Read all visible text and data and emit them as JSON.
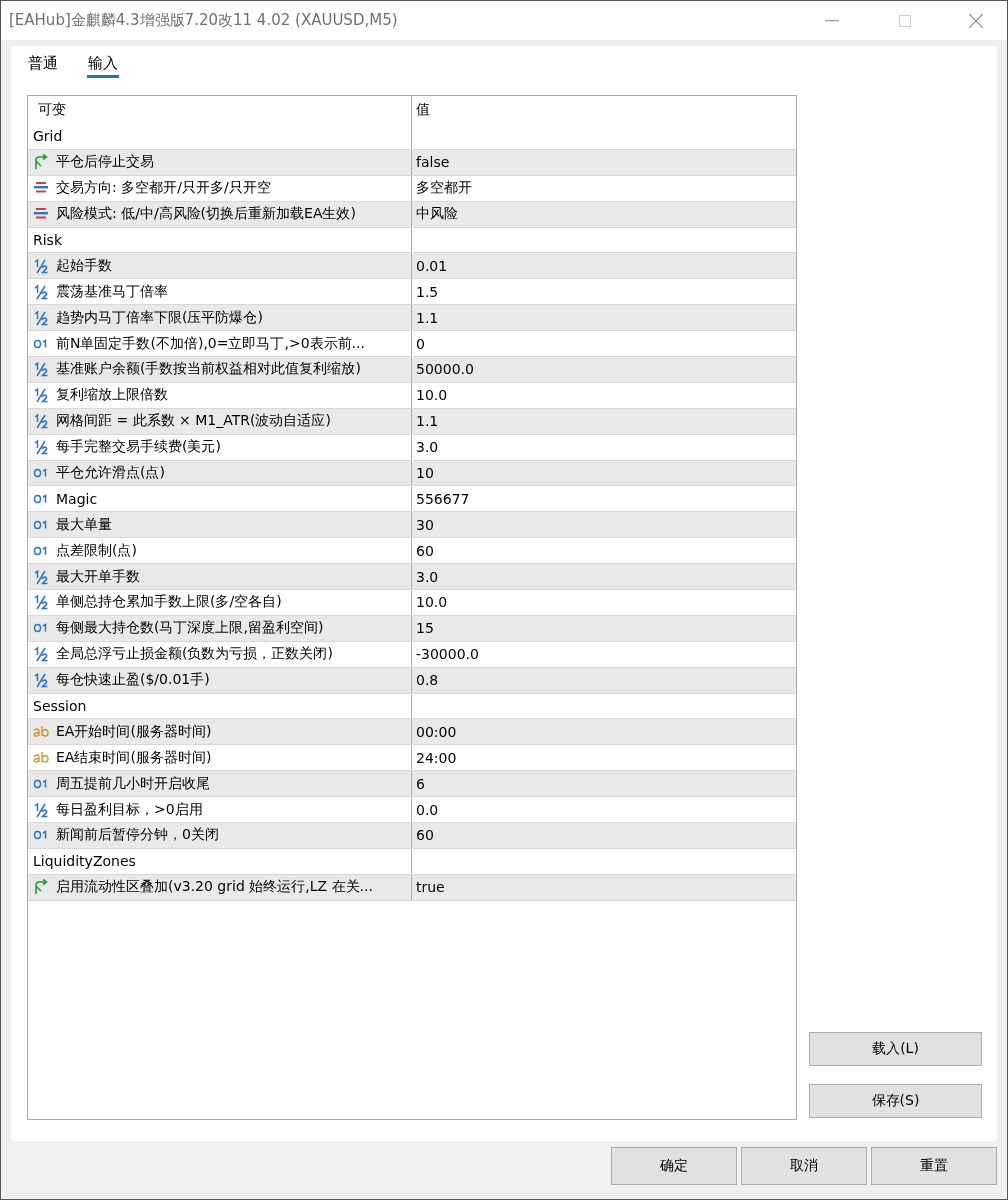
{
  "window": {
    "title": "[EAHub]金麒麟4.3增强版7.20改11 4.02 (XAUUSD,M5)"
  },
  "tabs": [
    {
      "label": "普通",
      "selected": false
    },
    {
      "label": "输入",
      "selected": true
    }
  ],
  "table": {
    "columns": [
      "可变",
      "值"
    ],
    "groups": [
      {
        "name": "Grid",
        "rows": [
          {
            "kind": "bool",
            "name": "平仓后停止交易",
            "value": "false"
          },
          {
            "kind": "enum",
            "name": "交易方向: 多空都开/只开多/只开空",
            "value": "多空都开"
          },
          {
            "kind": "enum",
            "name": "风险模式: 低/中/高风险(切换后重新加载EA生效)",
            "value": "中风险"
          }
        ]
      },
      {
        "name": "Risk",
        "rows": [
          {
            "kind": "double",
            "name": "起始手数",
            "value": "0.01"
          },
          {
            "kind": "double",
            "name": "震荡基准马丁倍率",
            "value": "1.5"
          },
          {
            "kind": "double",
            "name": "趋势内马丁倍率下限(压平防爆仓)",
            "value": "1.1"
          },
          {
            "kind": "int",
            "name": "前N单固定手数(不加倍),0=立即马丁,>0表示前...",
            "value": "0"
          },
          {
            "kind": "double",
            "name": "基准账户余额(手数按当前权益相对此值复利缩放)",
            "value": "50000.0"
          },
          {
            "kind": "double",
            "name": "复利缩放上限倍数",
            "value": "10.0"
          },
          {
            "kind": "double",
            "name": "网格间距 = 此系数 × M1_ATR(波动自适应)",
            "value": "1.1"
          },
          {
            "kind": "double",
            "name": "每手完整交易手续费(美元)",
            "value": "3.0"
          },
          {
            "kind": "int",
            "name": "平仓允许滑点(点)",
            "value": "10"
          },
          {
            "kind": "int",
            "name": "Magic",
            "value": "556677"
          },
          {
            "kind": "int",
            "name": "最大单量",
            "value": "30"
          },
          {
            "kind": "int",
            "name": "点差限制(点)",
            "value": "60"
          },
          {
            "kind": "double",
            "name": "最大开单手数",
            "value": "3.0"
          },
          {
            "kind": "double",
            "name": "单侧总持仓累加手数上限(多/空各自)",
            "value": "10.0"
          },
          {
            "kind": "int",
            "name": "每侧最大持仓数(马丁深度上限,留盈利空间)",
            "value": "15"
          },
          {
            "kind": "double",
            "name": "全局总浮亏止损金额(负数为亏损，正数关闭)",
            "value": "-30000.0"
          },
          {
            "kind": "double",
            "name": "每仓快速止盈($/0.01手)",
            "value": "0.8"
          }
        ]
      },
      {
        "name": "Session",
        "rows": [
          {
            "kind": "string",
            "name": "EA开始时间(服务器时间)",
            "value": "00:00"
          },
          {
            "kind": "string",
            "name": "EA结束时间(服务器时间)",
            "value": "24:00"
          },
          {
            "kind": "int",
            "name": "周五提前几小时开启收尾",
            "value": "6"
          },
          {
            "kind": "double",
            "name": "每日盈利目标，>0启用",
            "value": "0.0"
          },
          {
            "kind": "int",
            "name": "新闻前后暂停分钟，0关闭",
            "value": "60"
          }
        ]
      },
      {
        "name": "LiquidityZones",
        "rows": [
          {
            "kind": "bool",
            "name": "启用流动性区叠加(v3.20 grid 始终运行,LZ 在关...",
            "value": "true"
          }
        ]
      }
    ]
  },
  "side_buttons": [
    "载入(L)",
    "保存(S)"
  ],
  "buttons": [
    "确定",
    "取消",
    "重置"
  ]
}
